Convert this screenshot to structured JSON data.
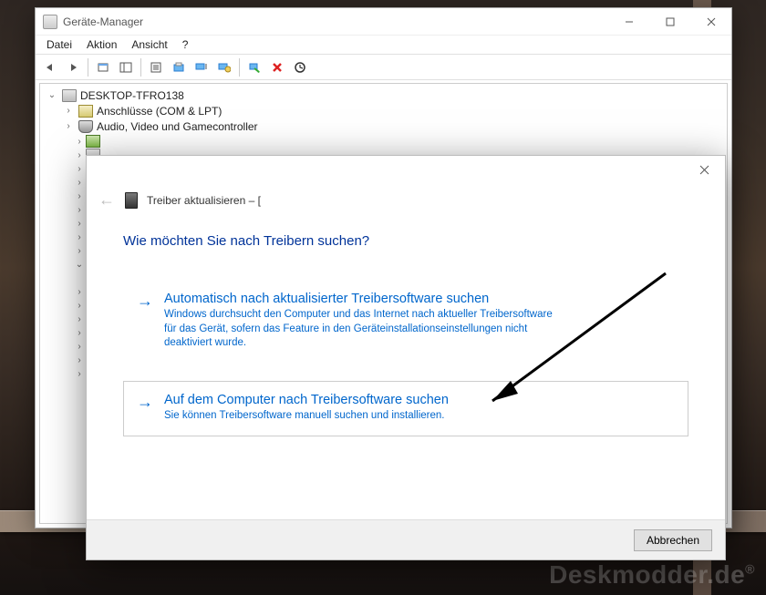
{
  "watermark": "Deskmodder.de",
  "main_window": {
    "title": "Geräte-Manager",
    "menu": {
      "file": "Datei",
      "action": "Aktion",
      "view": "Ansicht",
      "help": "?"
    },
    "toolbar_icons": [
      "back",
      "forward",
      "up",
      "view-panes",
      "properties",
      "refresh",
      "monitor-list",
      "monitor-config",
      "scan",
      "uninstall",
      "enable"
    ],
    "root": "DESKTOP-TFRO138",
    "children": [
      "Anschlüsse (COM & LPT)",
      "Audio, Video und Gamecontroller"
    ]
  },
  "dialog": {
    "crumb": "Treiber aktualisieren – [",
    "question": "Wie möchten Sie nach Treibern suchen?",
    "opt1": {
      "title": "Automatisch nach aktualisierter Treibersoftware suchen",
      "desc": "Windows durchsucht den Computer und das Internet nach aktueller Treibersoftware für das Gerät, sofern das Feature in den Geräteinstallationseinstellungen nicht deaktiviert wurde."
    },
    "opt2": {
      "title": "Auf dem Computer nach Treibersoftware suchen",
      "desc": "Sie können Treibersoftware manuell suchen und installieren."
    },
    "cancel": "Abbrechen"
  }
}
